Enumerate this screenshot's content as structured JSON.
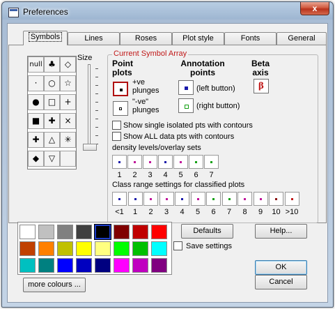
{
  "window": {
    "title": "Preferences",
    "close_label": "x"
  },
  "tabs": [
    {
      "label": "Symbols",
      "active": true
    },
    {
      "label": "Lines",
      "active": false
    },
    {
      "label": "Roses",
      "active": false
    },
    {
      "label": "Plot style",
      "active": false
    },
    {
      "label": "Fonts",
      "active": false
    },
    {
      "label": "General",
      "active": false
    }
  ],
  "symbols": {
    "size_label": "Size",
    "grid": [
      [
        "null",
        "♣",
        "◇"
      ],
      [
        "·",
        "○",
        "☆"
      ],
      [
        "●",
        "□",
        "+"
      ],
      [
        "■",
        "✚",
        "×"
      ],
      [
        "✚",
        "△",
        "✳"
      ],
      [
        "◆",
        "▽",
        ""
      ]
    ]
  },
  "current_symbol_array": {
    "title": "Current Symbol Array",
    "point_plots_header": "Point plots",
    "annotation_header": "Annotation points",
    "beta_header": "Beta axis",
    "ve_plunges": "+ve plunges",
    "neg_ve_plunges": "\"-ve\" plunges",
    "left_button": "(left button)",
    "right_button": "(right button)",
    "beta_symbol": "β",
    "show_single": "Show single isolated pts with contours",
    "show_all": "Show ALL data pts with contours",
    "density_label": "density levels/overlay sets",
    "density_numbers": [
      "1",
      "2",
      "3",
      "4",
      "5",
      "6",
      "7"
    ],
    "density_colors": [
      "#1a1aaa",
      "#c0149a",
      "#c0149a",
      "#1a1aaa",
      "#c0149a",
      "#14a014",
      "#14a014"
    ],
    "class_label": "Class range settings for classified plots",
    "class_numbers": [
      "<1",
      "1",
      "2",
      "3",
      "4",
      "5",
      "6",
      "7",
      "8",
      "9",
      "10",
      ">10"
    ],
    "class_colors": [
      "#1a1aaa",
      "#1a1aaa",
      "#c0149a",
      "#c0149a",
      "#1a1aaa",
      "#c0149a",
      "#14a014",
      "#14a014",
      "#c0149a",
      "#c0149a",
      "#8a1010",
      "#c01818"
    ]
  },
  "palette": {
    "colors": [
      [
        "#ffffff",
        "#c0c0c0",
        "#808080",
        "#404040",
        "#000000",
        "#800000",
        "#c00000",
        "#ff0000"
      ],
      [
        "#c04000",
        "#ff8000",
        "#c0c000",
        "#ffff00",
        "#ffff80",
        "#00ff00",
        "#00c000",
        "#00ffff"
      ],
      [
        "#00c0c0",
        "#008080",
        "#0000ff",
        "#0000c0",
        "#000080",
        "#ff00ff",
        "#c000c0",
        "#800080"
      ]
    ],
    "selected_row": 0,
    "selected_col": 4,
    "more_colours_label": "more colours ..."
  },
  "buttons": {
    "defaults": "Defaults",
    "help": "Help...",
    "save_settings": "Save settings",
    "ok": "OK",
    "cancel": "Cancel"
  }
}
